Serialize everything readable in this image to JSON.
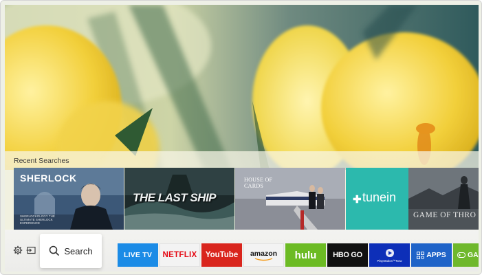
{
  "recent_searches": {
    "title": "Recent Searches",
    "items": [
      {
        "title": "SHERLOCK",
        "caption": "SHERLOCKOLOGY THE ULTIMATE SHERLOCK EXPERIENCE"
      },
      {
        "title": "THE LAST SHIP"
      },
      {
        "title": "HOUSE OF CARDS"
      },
      {
        "title": "tunein"
      },
      {
        "title": "GAME OF THRO"
      }
    ]
  },
  "bottom_bar": {
    "search_label": "Search",
    "apps": [
      {
        "id": "livetv",
        "label": "LIVE TV"
      },
      {
        "id": "netflix",
        "label": "NETFLIX"
      },
      {
        "id": "youtube",
        "label": "YouTube"
      },
      {
        "id": "amazon",
        "label": "amazon"
      },
      {
        "id": "hulu",
        "label": "hulu"
      },
      {
        "id": "hbogo",
        "label": "HBO GO"
      },
      {
        "id": "psnow",
        "label": "PlayStation™Now"
      },
      {
        "id": "apps",
        "label": "APPS"
      },
      {
        "id": "games",
        "label": "GAM"
      }
    ]
  },
  "colors": {
    "live_tv": "#1b8be6",
    "netflix": "#e50914",
    "youtube": "#d9251d",
    "hulu": "#6cbb24",
    "hbo_go": "#111111",
    "playstation_now": "#0d2fb8",
    "apps": "#1f63c8",
    "games": "#6fb82c",
    "tunein": "#2cb9ad"
  },
  "icons": {
    "settings": "gear-icon",
    "source": "input-source-icon",
    "search": "magnifier-icon"
  }
}
